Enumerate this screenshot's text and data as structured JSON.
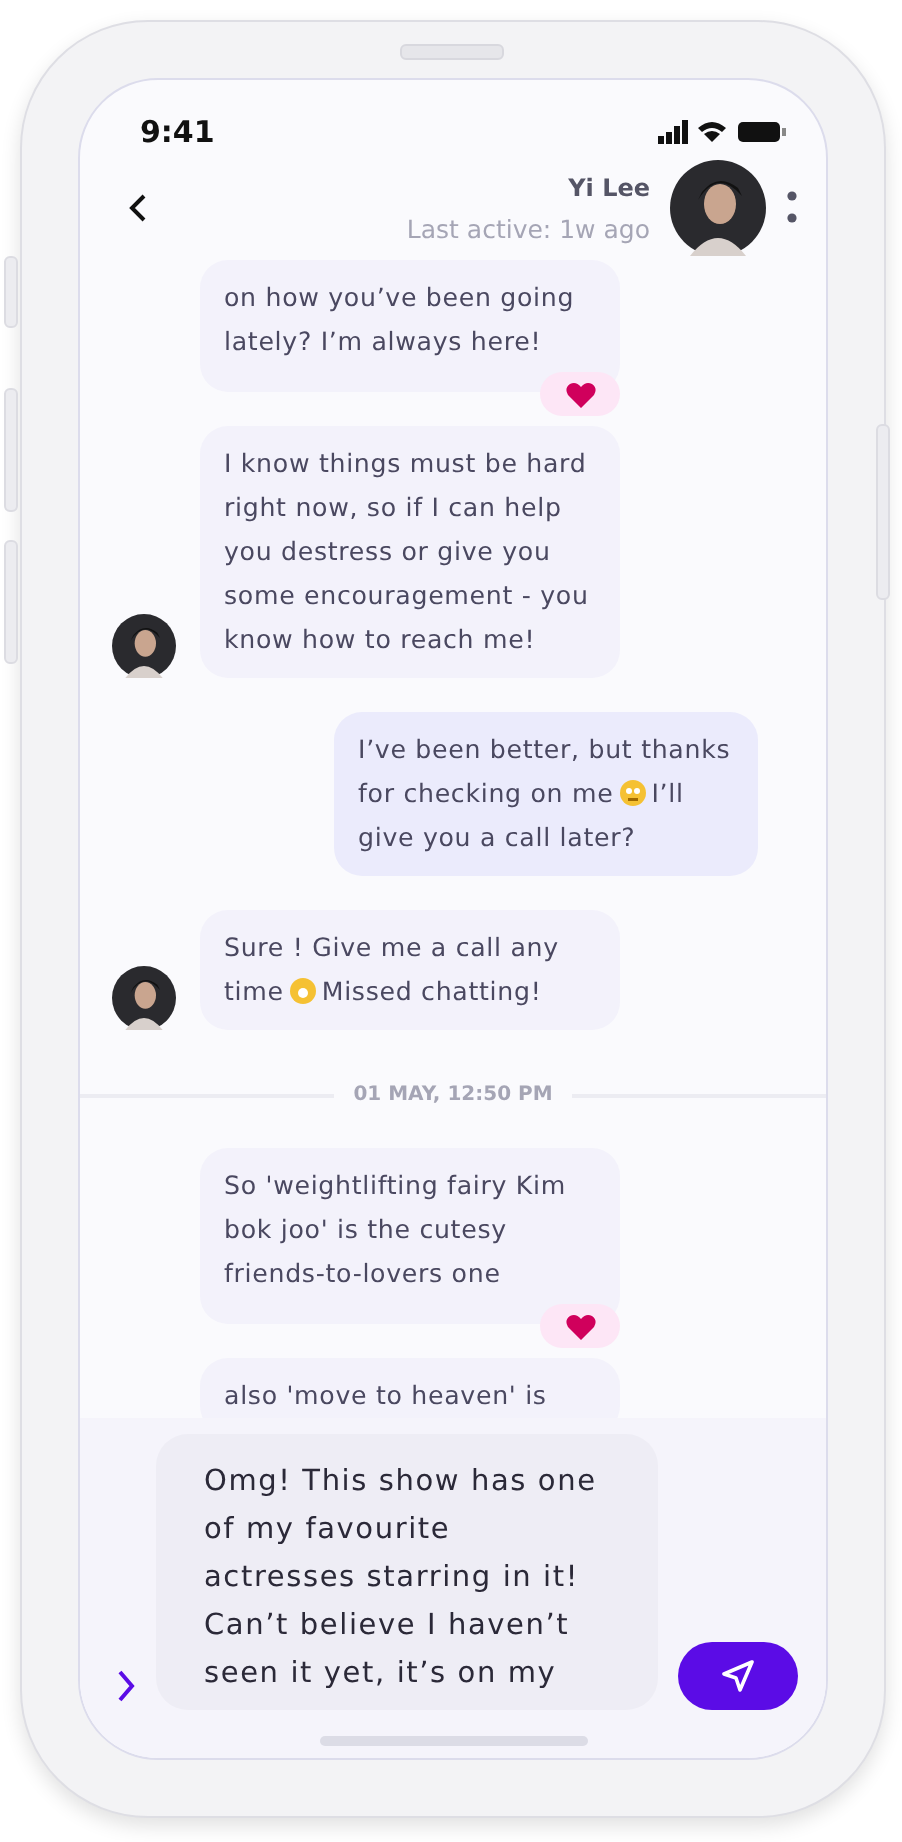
{
  "status_bar": {
    "time": "9:41"
  },
  "header": {
    "name": "Yi Lee",
    "last_active": "Last active: 1w ago"
  },
  "messages": [
    {
      "kind": "received",
      "avatar": false,
      "liked": true,
      "parts": [
        {
          "kind": "text",
          "text": "on how you’ve been going lately? I’m always here!"
        }
      ]
    },
    {
      "kind": "received",
      "avatar": true,
      "liked": false,
      "parts": [
        {
          "kind": "text",
          "text": "I know things must be hard right now, so if I can help you destress or give you some encouragement - you know how to reach me!"
        }
      ]
    },
    {
      "kind": "sent",
      "liked": false,
      "parts": [
        {
          "kind": "text",
          "text": "I’ve been better, but thanks for checking on me"
        },
        {
          "kind": "emoji"
        },
        {
          "kind": "text",
          "text": "I’ll give you a call later?"
        }
      ]
    },
    {
      "kind": "received",
      "avatar": true,
      "liked": false,
      "parts": [
        {
          "kind": "text",
          "text": "Sure ! Give me a call any time"
        },
        {
          "kind": "emoji"
        },
        {
          "kind": "text",
          "text": "Missed chatting!"
        }
      ]
    },
    {
      "kind": "divider",
      "text": "01 MAY, 12:50 PM"
    },
    {
      "kind": "received",
      "avatar": false,
      "liked": true,
      "parts": [
        {
          "kind": "text",
          "text": "So 'weightlifting fairy Kim bok joo' is the cutesy friends-to-lovers one"
        }
      ]
    },
    {
      "kind": "received",
      "avatar": false,
      "liked": false,
      "parts": [
        {
          "kind": "text",
          "text": "also 'move to heaven' is"
        }
      ]
    }
  ],
  "composer": {
    "value": "Omg! This show has one of my favourite actresses starring in it! Can’t believe I haven’t seen it yet, it’s on my"
  }
}
